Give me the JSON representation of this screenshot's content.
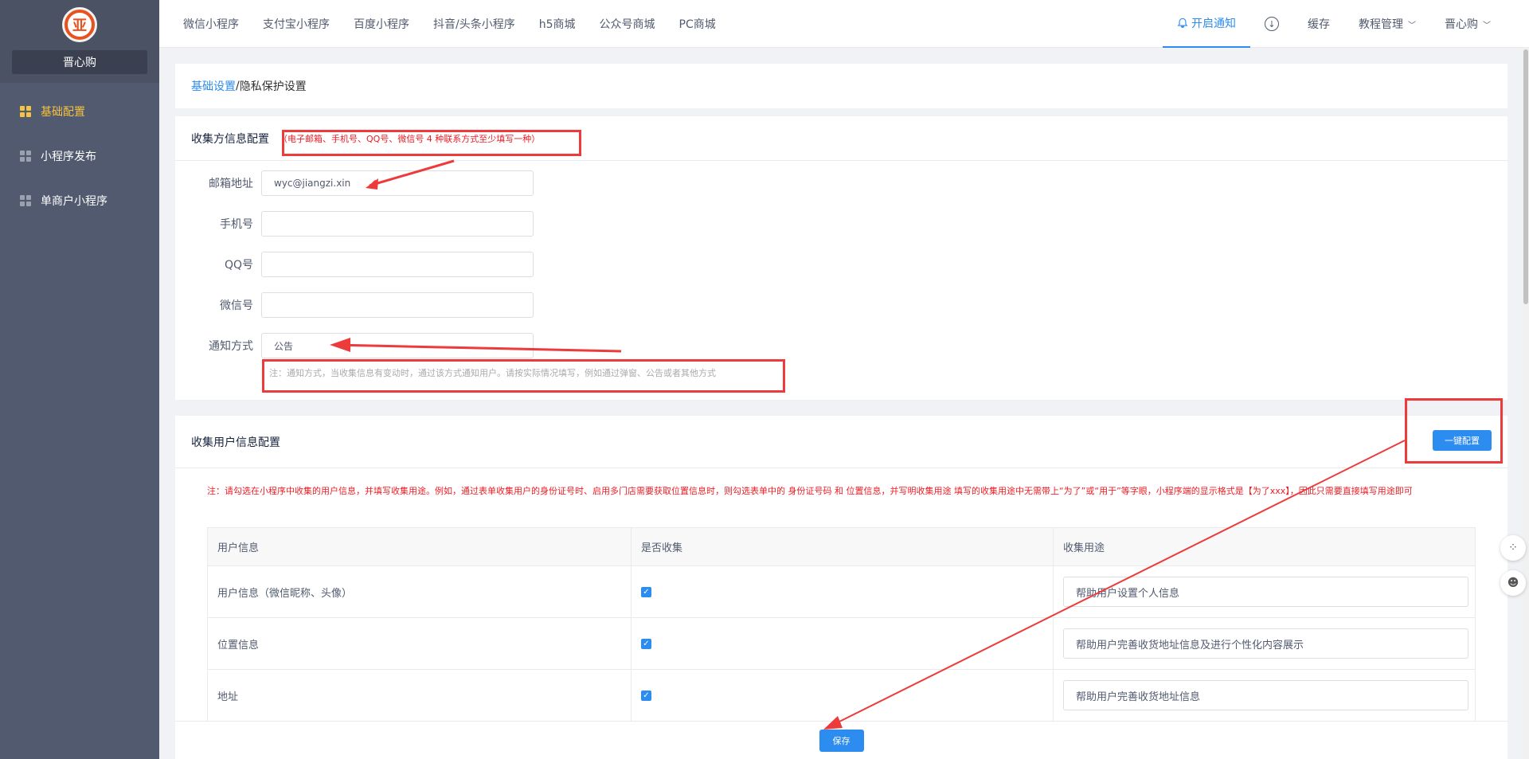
{
  "brand": {
    "name": "晋心购",
    "logo_char": "亚"
  },
  "sidebar": {
    "items": [
      {
        "label": "基础配置"
      },
      {
        "label": "小程序发布"
      },
      {
        "label": "单商户小程序"
      }
    ]
  },
  "topnav": {
    "items": [
      {
        "label": "微信小程序"
      },
      {
        "label": "支付宝小程序"
      },
      {
        "label": "百度小程序"
      },
      {
        "label": "抖音/头条小程序"
      },
      {
        "label": "h5商城"
      },
      {
        "label": "公众号商城"
      },
      {
        "label": "PC商城"
      }
    ],
    "notice": "开启通知",
    "download_glyph": "↓",
    "cache": "缓存",
    "tutorial": "教程管理",
    "user": "晋心购",
    "chevron": "﹀"
  },
  "breadcrumb": {
    "link": "基础设置",
    "sep": " / ",
    "current": "隐私保护设置"
  },
  "collector": {
    "title": "收集方信息配置",
    "tip": "（电子邮箱、手机号、QQ号、微信号 4 种联系方式至少填写一种）",
    "fields": [
      {
        "label": "邮箱地址",
        "value": "wyc@jiangzi.xin"
      },
      {
        "label": "手机号",
        "value": ""
      },
      {
        "label": "QQ号",
        "value": ""
      },
      {
        "label": "微信号",
        "value": ""
      },
      {
        "label": "通知方式",
        "value": "公告"
      }
    ],
    "hint": "注：通知方式，当收集信息有变动时，通过该方式通知用户。请按实际情况填写，例如通过弹窗、公告或者其他方式"
  },
  "userinfo": {
    "title": "收集用户信息配置",
    "one_key_button": "一键配置",
    "note": "注：请勾选在小程序中收集的用户信息，并填写收集用途。例如，通过表单收集用户的身份证号时、启用多门店需要获取位置信息时，则勾选表单中的 身份证号码 和 位置信息，并写明收集用途 填写的收集用途中无需带上“为了”或“用于”等字眼，小程序端的显示格式是【为了xxx】，因此只需要直接填写用途即可",
    "columns": [
      "用户信息",
      "是否收集",
      "收集用途"
    ],
    "rows": [
      {
        "name": "用户信息（微信昵称、头像）",
        "checked": true,
        "purpose": "帮助用户设置个人信息"
      },
      {
        "name": "位置信息",
        "checked": true,
        "purpose": "帮助用户完善收货地址信息及进行个性化内容展示"
      },
      {
        "name": "地址",
        "checked": true,
        "purpose": "帮助用户完善收货地址信息"
      }
    ],
    "check_glyph": "✓"
  },
  "footer": {
    "save_button": "保存"
  },
  "floating": {
    "apps_icon": "⁘",
    "bot_icon": "☻"
  },
  "colors": {
    "primary": "#2d8cf0",
    "sidebar": "#515a6e",
    "active": "#f5c242",
    "annotation": "#ed3b3b"
  }
}
